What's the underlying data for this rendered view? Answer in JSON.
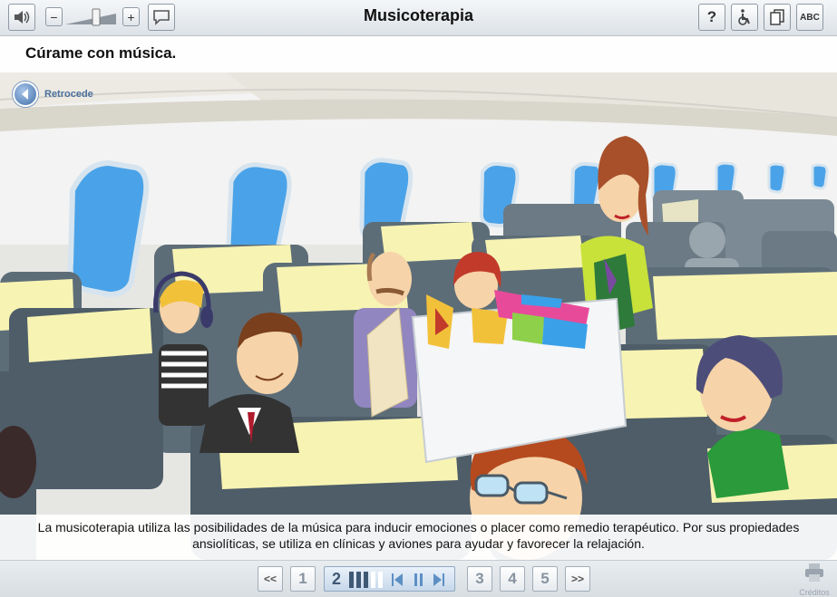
{
  "app": {
    "title": "Musicoterapia"
  },
  "toolbar": {
    "volume_icon": "speaker-icon",
    "minus_label": "−",
    "plus_label": "+",
    "subtitles_icon": "speech-bubble-icon",
    "help_label": "?",
    "accessibility_icon": "wheelchair-icon",
    "copy_icon": "copy-icon",
    "abc_label": "ABC"
  },
  "content": {
    "heading": "Cúrame con música.",
    "back_label": "Retrocede",
    "caption": "La musicoterapia utiliza las posibilidades de la música para inducir emociones o placer como remedio terapéutico. Por sus propiedades ansiolíticas, se utiliza en clínicas y aviones para ayudar y favorecer la relajación."
  },
  "pagination": {
    "first_label": "<<",
    "last_label": ">>",
    "pages": [
      "1",
      "2",
      "3",
      "4",
      "5"
    ],
    "current_page": "2"
  },
  "footer": {
    "credits_label": "Créditos"
  },
  "colors": {
    "accent": "#3f6ea8",
    "window_blue": "#4aa3e8",
    "seat_gray": "#5d6d78",
    "headrest_yellow": "#f7f3b3"
  }
}
